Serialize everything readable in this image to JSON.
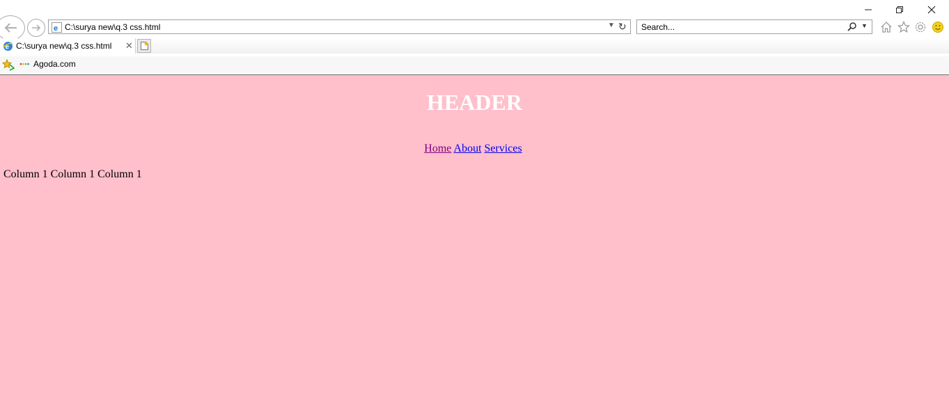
{
  "browser": {
    "address_url": "C:\\surya new\\q.3 css.html",
    "search_placeholder": "Search...",
    "tab_title": "C:\\surya new\\q.3 css.html",
    "tab_close": "✕",
    "favorites": [
      {
        "label": "Agoda.com"
      }
    ],
    "icons": {
      "back": "back-arrow-icon",
      "forward": "forward-arrow-icon",
      "refresh": "refresh-icon",
      "search": "magnifier-icon",
      "home": "home-icon",
      "favorites": "star-icon",
      "tools": "gear-icon",
      "feedback": "smiley-icon"
    }
  },
  "page": {
    "header": "HEADER",
    "nav": [
      {
        "label": "Home",
        "visited": true
      },
      {
        "label": "About",
        "visited": false
      },
      {
        "label": "Services",
        "visited": false
      }
    ],
    "columns": [
      "Column 1",
      "Column 1",
      "Column 1"
    ],
    "colors": {
      "background": "#ffc0cb",
      "header_text": "#ffffff",
      "link": "#0000ee",
      "visited_link": "#800080"
    }
  }
}
